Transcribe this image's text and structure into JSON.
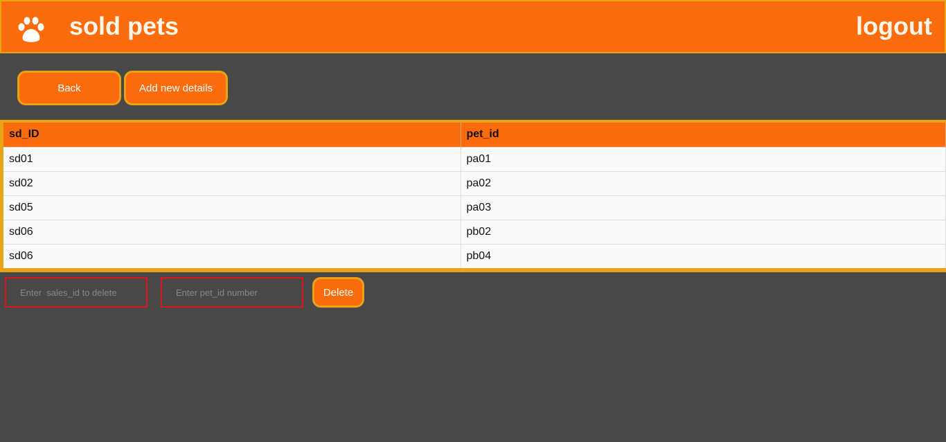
{
  "header": {
    "title": "sold pets",
    "logout_label": "logout",
    "logo_icon": "paw-icon",
    "bg_color": "#fa6b0e"
  },
  "actions": {
    "back_label": "Back",
    "add_label": "Add new details"
  },
  "table": {
    "columns": [
      "sd_ID",
      "pet_id"
    ],
    "rows": [
      [
        "sd01",
        "pa01"
      ],
      [
        "sd02",
        "pa02"
      ],
      [
        "sd05",
        "pa03"
      ],
      [
        "sd06",
        "pb02"
      ],
      [
        "sd06",
        "pb04"
      ]
    ]
  },
  "delete_form": {
    "sales_placeholder": "Enter  sales_id to delete",
    "pet_placeholder": "Enter pet_id number",
    "delete_label": "Delete"
  }
}
